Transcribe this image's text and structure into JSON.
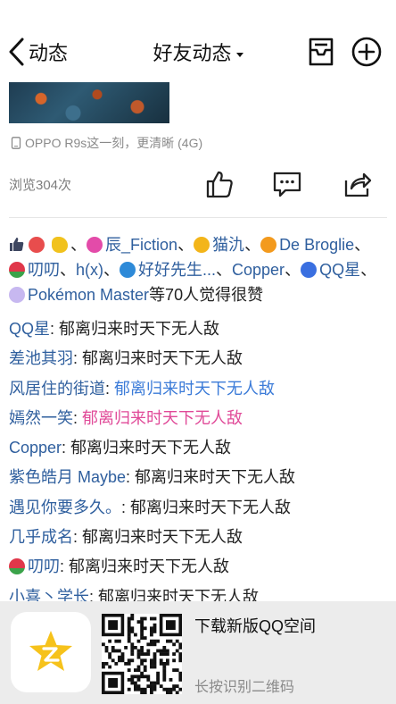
{
  "nav": {
    "back_label": "动态",
    "title": "好友动态"
  },
  "post": {
    "device": "OPPO R9s这一刻，更清晰 (4G)",
    "views": "浏览304次"
  },
  "likes": {
    "users": [
      "辰_Fiction",
      "猫氿",
      "De Broglie",
      "叨叨",
      "h(x)",
      "好好先生...",
      "Copper",
      "QQ星",
      "Pokémon Master"
    ],
    "suffix": "等70人觉得很赞"
  },
  "comments": [
    {
      "name": "QQ星",
      "text": "郁离归来时天下无人敌",
      "style": ""
    },
    {
      "name": "差池其羽",
      "text": "郁离归来时天下无人敌",
      "style": ""
    },
    {
      "name": "风居住的街道",
      "text": "郁离归来时天下无人敌",
      "style": "blue"
    },
    {
      "name": "嫣然一笑",
      "text": "郁离归来时天下无人敌",
      "style": "pink"
    },
    {
      "name": "Copper",
      "text": "郁离归来时天下无人敌",
      "style": ""
    },
    {
      "name": "紫色皓月 Maybe",
      "text": "郁离归来时天下无人敌",
      "style": ""
    },
    {
      "name": "遇见你要多久。",
      "text": "郁离归来时天下无人敌",
      "style": ""
    },
    {
      "name": "几乎成名",
      "text": "郁离归来时天下无人敌",
      "style": ""
    },
    {
      "name": "叨叨",
      "text": "郁离归来时天下无人敌",
      "style": ""
    },
    {
      "name": "小喜丶学长",
      "text": "郁离归来时天下无人敌",
      "style": ""
    }
  ],
  "banner": {
    "download": "下载新版QQ空间",
    "hint": "长按识别二维码"
  },
  "colors": {
    "link": "#2f5f9e",
    "blue_text": "#3b7bd8",
    "pink_text": "#e04a98",
    "qzone_yellow": "#f6c21b"
  },
  "icons": [
    "back-chevron-icon",
    "dropdown-caret-icon",
    "inbox-icon",
    "plus-circle-icon",
    "phone-icon",
    "thumbs-up-icon",
    "comment-icon",
    "share-icon",
    "qzone-star-icon",
    "qr-code-icon"
  ]
}
